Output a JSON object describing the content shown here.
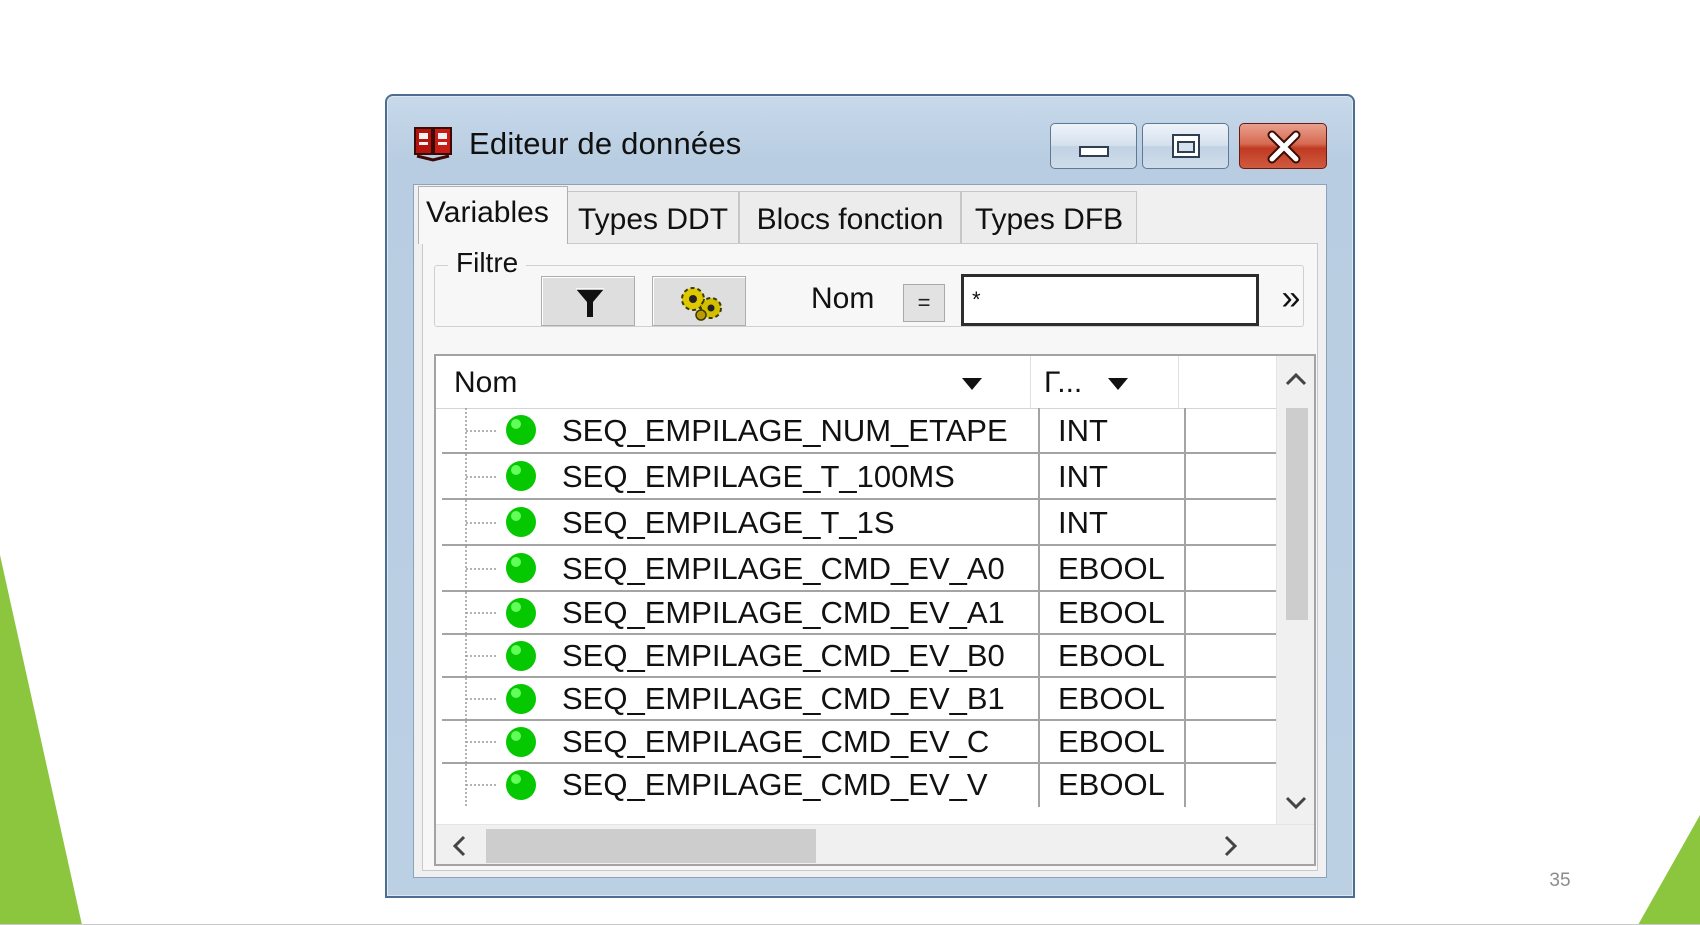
{
  "window": {
    "title": "Editeur de données",
    "controls": {
      "minimize": "minimize",
      "maximize": "maximize",
      "close": "close"
    }
  },
  "tabs": [
    {
      "label": "Variables",
      "active": true
    },
    {
      "label": "Types DDT",
      "active": false
    },
    {
      "label": "Blocs fonction",
      "active": false
    },
    {
      "label": "Types DFB",
      "active": false
    }
  ],
  "filter": {
    "legend": "Filtre",
    "name_label": "Nom",
    "operator": "=",
    "value": "*",
    "expand": "»"
  },
  "table": {
    "columns": [
      {
        "label": "Nom"
      },
      {
        "label": "Γ..."
      }
    ],
    "rows": [
      {
        "name": "SEQ_EMPILAGE_NUM_ETAPE",
        "type": "INT"
      },
      {
        "name": "SEQ_EMPILAGE_T_100MS",
        "type": "INT"
      },
      {
        "name": "SEQ_EMPILAGE_T_1S",
        "type": "INT"
      },
      {
        "name": "SEQ_EMPILAGE_CMD_EV_A0",
        "type": "EBOOL"
      },
      {
        "name": "SEQ_EMPILAGE_CMD_EV_A1",
        "type": "EBOOL"
      },
      {
        "name": "SEQ_EMPILAGE_CMD_EV_B0",
        "type": "EBOOL"
      },
      {
        "name": "SEQ_EMPILAGE_CMD_EV_B1",
        "type": "EBOOL"
      },
      {
        "name": "SEQ_EMPILAGE_CMD_EV_C",
        "type": "EBOOL"
      },
      {
        "name": "SEQ_EMPILAGE_CMD_EV_V",
        "type": "EBOOL"
      }
    ]
  },
  "slide": {
    "page_number": "35"
  },
  "icons": {
    "app": "data-editor-icon",
    "filter": "funnel-icon",
    "reset": "gears-icon",
    "status": "green-dot-icon"
  },
  "colors": {
    "accent_green": "#8cc63f",
    "status_green": "#00d000",
    "close_red": "#c8452d",
    "window_frame": "#bcd0e4"
  }
}
